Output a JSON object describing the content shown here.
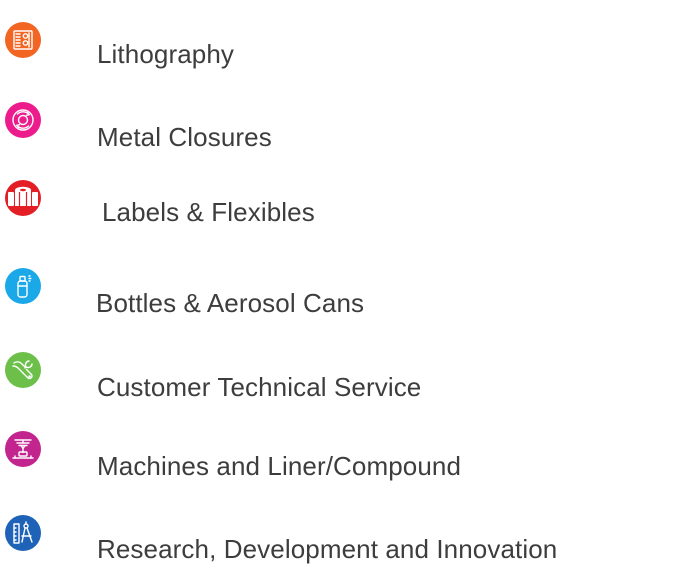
{
  "services": [
    {
      "label": "Lithography",
      "icon": "lithography-icon",
      "color": "#f26522"
    },
    {
      "label": "Metal Closures",
      "icon": "metal-closures-icon",
      "color": "#ec1c8c"
    },
    {
      "label": "Labels & Flexibles",
      "icon": "labels-roll-icon",
      "color": "#e31e24"
    },
    {
      "label": "Bottles & Aerosol Cans",
      "icon": "aerosol-can-icon",
      "color": "#1ba8e8"
    },
    {
      "label": "Customer Technical Service",
      "icon": "wrench-hand-icon",
      "color": "#6cc04a"
    },
    {
      "label": "Machines and Liner/Compound",
      "icon": "machine-icon",
      "color": "#c3258f"
    },
    {
      "label": "Research, Development and Innovation",
      "icon": "drafting-compass-icon",
      "color": "#1e63b8"
    }
  ]
}
